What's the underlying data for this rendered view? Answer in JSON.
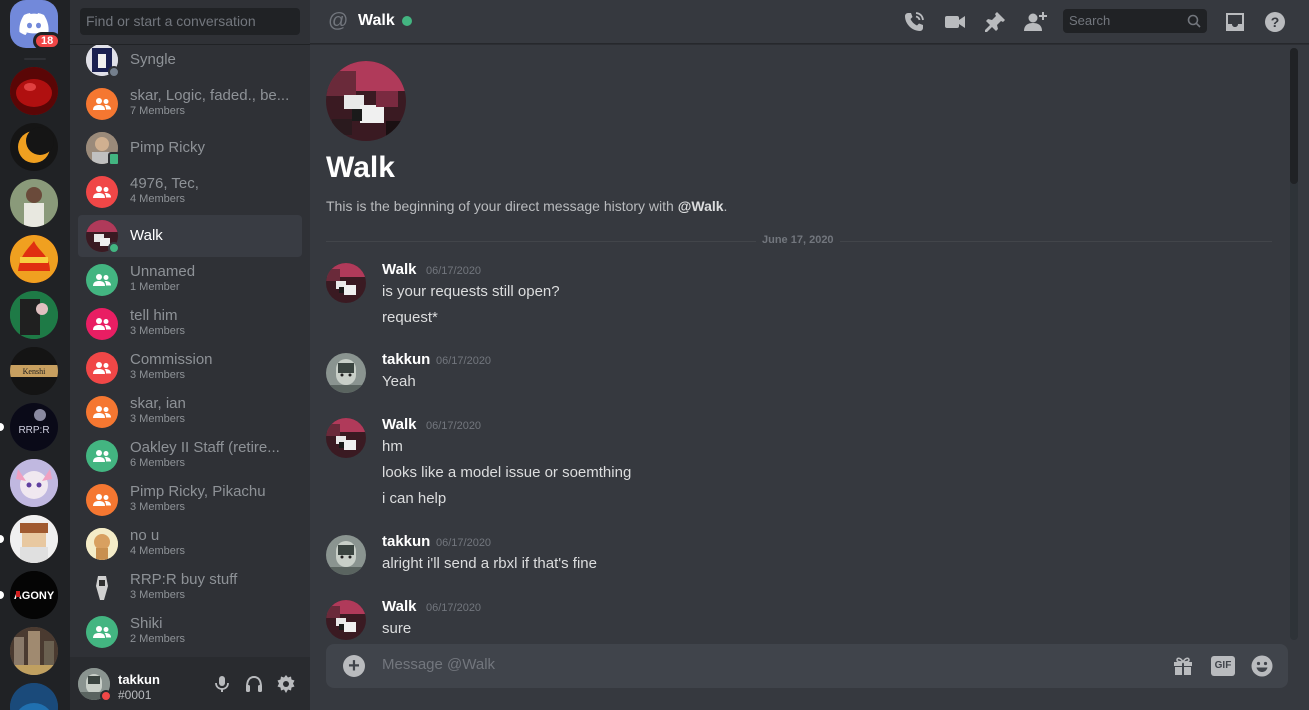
{
  "rail": {
    "home_badge": "18",
    "servers": [
      {
        "name": "server-red",
        "color": "#8b0a0a"
      },
      {
        "name": "server-moon",
        "color": "#151515"
      },
      {
        "name": "server-gta",
        "color": "#4a5a3a"
      },
      {
        "name": "server-fire",
        "color": "#d94a10"
      },
      {
        "name": "server-green",
        "color": "#1e7a46"
      },
      {
        "name": "server-kenshi",
        "color": "#141414"
      },
      {
        "name": "server-rrpr",
        "color": "#1a1a2e"
      },
      {
        "name": "server-anime",
        "color": "#b8a8d8"
      },
      {
        "name": "server-roblox",
        "color": "#c8a890"
      },
      {
        "name": "server-agony",
        "color": "#050505"
      },
      {
        "name": "server-city",
        "color": "#6a5a4a"
      },
      {
        "name": "server-blue",
        "color": "#1a4a7a"
      }
    ]
  },
  "sidebar": {
    "search_placeholder": "Find or start a conversation",
    "dms": [
      {
        "name": "Syngle",
        "sub": "",
        "avatar_color": "#cccccc",
        "kind": "user"
      },
      {
        "name": "skar, Logic, faded., be...",
        "sub": "7 Members",
        "avatar_color": "#f57731",
        "kind": "group"
      },
      {
        "name": "Pimp Ricky",
        "sub": "",
        "avatar_color": "#8a7a6a",
        "kind": "user"
      },
      {
        "name": "4976, Tec,",
        "sub": "4 Members",
        "avatar_color": "#f04747",
        "kind": "group"
      },
      {
        "name": "Walk",
        "sub": "",
        "avatar_color": "#5a2a3a",
        "kind": "user"
      },
      {
        "name": "Unnamed",
        "sub": "1 Member",
        "avatar_color": "#43b581",
        "kind": "group"
      },
      {
        "name": "tell him",
        "sub": "3 Members",
        "avatar_color": "#e91e63",
        "kind": "group"
      },
      {
        "name": "Commission",
        "sub": "3 Members",
        "avatar_color": "#f04747",
        "kind": "group"
      },
      {
        "name": "skar, ian",
        "sub": "3 Members",
        "avatar_color": "#f57731",
        "kind": "group"
      },
      {
        "name": "Oakley II Staff (retire...",
        "sub": "6 Members",
        "avatar_color": "#43b581",
        "kind": "group"
      },
      {
        "name": "Pimp Ricky, Pikachu",
        "sub": "3 Members",
        "avatar_color": "#f57731",
        "kind": "group"
      },
      {
        "name": "no u",
        "sub": "4 Members",
        "avatar_color": "#f0e0a0",
        "kind": "image"
      },
      {
        "name": "RRP:R buy stuff",
        "sub": "3 Members",
        "avatar_color": "#2f3136",
        "kind": "image"
      },
      {
        "name": "Shiki",
        "sub": "2 Members",
        "avatar_color": "#43b581",
        "kind": "group"
      }
    ]
  },
  "user_panel": {
    "username": "takkun",
    "tag": "#0001"
  },
  "header": {
    "channel_name": "Walk",
    "search_placeholder": "Search"
  },
  "intro": {
    "title": "Walk",
    "text_prefix": "This is the beginning of your direct message history with ",
    "text_mention": "@Walk",
    "text_suffix": "."
  },
  "date_divider": "June 17, 2020",
  "messages": [
    {
      "author": "Walk",
      "time": "06/17/2020",
      "lines": [
        "is your requests still open?",
        "request*"
      ],
      "avatar": "walk"
    },
    {
      "author": "takkun",
      "time": "06/17/2020",
      "lines": [
        "Yeah"
      ],
      "avatar": "takkun"
    },
    {
      "author": "Walk",
      "time": "06/17/2020",
      "lines": [
        "hm",
        "looks like a model issue or soemthing",
        "i can help"
      ],
      "avatar": "walk"
    },
    {
      "author": "takkun",
      "time": "06/17/2020",
      "lines": [
        "alright i'll send a rbxl if that's fine"
      ],
      "avatar": "takkun"
    },
    {
      "author": "Walk",
      "time": "06/17/2020",
      "lines": [
        "sure"
      ],
      "avatar": "walk"
    }
  ],
  "composer": {
    "placeholder": "Message @Walk",
    "gif_label": "GIF"
  },
  "colors": {
    "accent": "#7289da",
    "online": "#43b581",
    "dnd": "#f04747"
  }
}
